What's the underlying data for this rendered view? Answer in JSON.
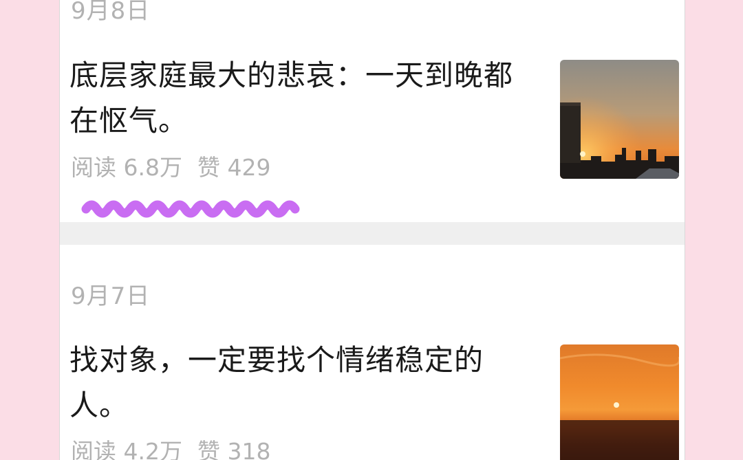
{
  "articles": [
    {
      "date": "9月8日",
      "title": "底层家庭最大的悲哀：一天到晚都在怄气。",
      "reads_label": "阅读 6.8万",
      "likes_label": "赞 429",
      "thumb_icon": "city-sunset-thumbnail",
      "highlight_color": "#c96df2"
    },
    {
      "date": "9月7日",
      "title": "找对象，一定要找个情绪稳定的人。",
      "reads_label": "阅读 4.2万",
      "likes_label": "赞 318",
      "thumb_icon": "horizon-sunset-thumbnail"
    }
  ]
}
